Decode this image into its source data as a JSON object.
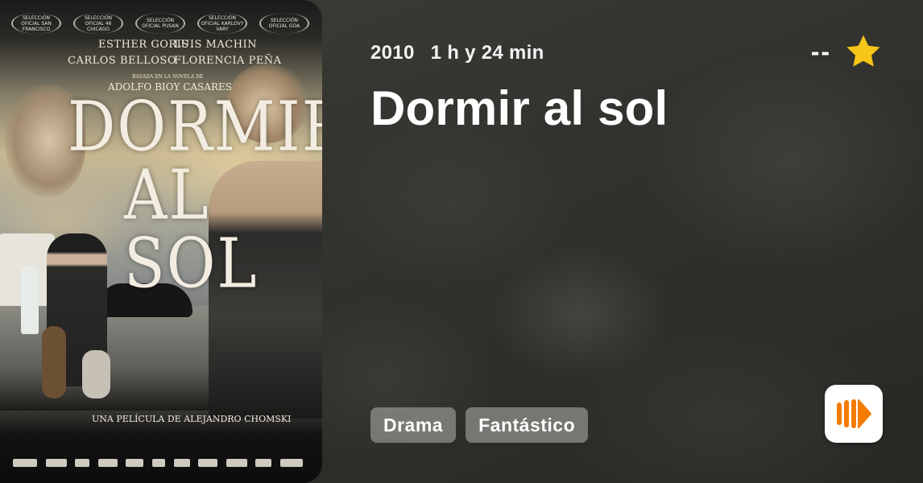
{
  "movie": {
    "year": "2010",
    "duration": "1 h y 24 min",
    "title": "Dormir al sol",
    "rating": "--",
    "genres": [
      "Drama",
      "Fantástico"
    ]
  },
  "poster": {
    "festivals": [
      "SELECCIÓN OFICIAL SAN FRANCISCO",
      "SELECCIÓN OFICIAL 46 CHICAGO",
      "SELECCIÓN OFICIAL PUSAN",
      "SELECCIÓN OFICIAL KARLOVY VARY",
      "SELECCIÓN OFICIAL GOA"
    ],
    "cast_1": "ESTHER GORIS",
    "cast_2": "LUIS MACHIN",
    "cast_3": "CARLOS BELLOSO",
    "cast_4": "FLORENCIA PEÑA",
    "based_on": "BASADA EN LA NOVELA DE",
    "author": "ADOLFO BIOY CASARES",
    "title_line1": "DORMIR",
    "title_line2": "AL SOL",
    "director_line": "UNA PELÍCULA DE ALEJANDRO CHOMSKI"
  },
  "colors": {
    "star": "#F5C518",
    "play_icon": "#F57C00",
    "chip_bg": "rgba(180,180,175,0.55)"
  },
  "icons": {
    "rating": "star-icon",
    "play": "play-stream-icon"
  }
}
